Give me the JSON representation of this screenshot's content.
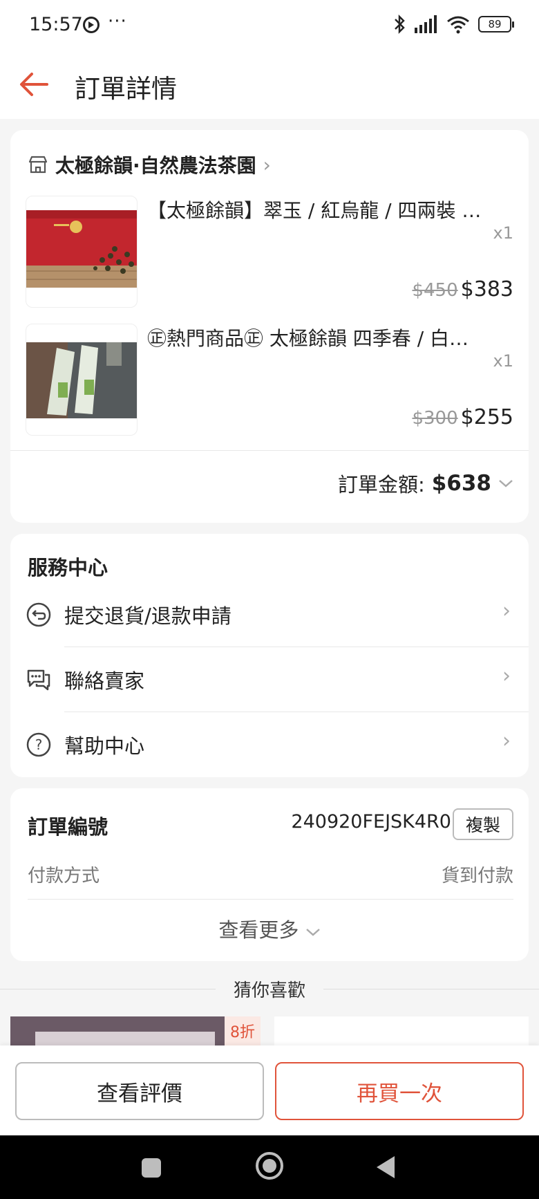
{
  "status_bar": {
    "time": "15:57",
    "dots": "···",
    "battery": "89"
  },
  "header": {
    "title": "訂單詳情"
  },
  "shop": {
    "name": "太極餘韻·自然農法茶園"
  },
  "products": [
    {
      "title": "【太極餘韻】翠玉 / 紅烏龍 / 四兩裝 …",
      "qty": "x1",
      "price_original": "$450",
      "price": "$383"
    },
    {
      "title": "㊣熱門商品㊣ 太極餘韻 四季春 / 白…",
      "qty": "x1",
      "price_original": "$300",
      "price": "$255"
    }
  ],
  "order_total": {
    "label": "訂單金額:",
    "value": "$638"
  },
  "service_center": {
    "title": "服務中心",
    "items": [
      {
        "label": "提交退貨/退款申請",
        "icon": "return-icon"
      },
      {
        "label": "聯絡賣家",
        "icon": "chat-icon"
      },
      {
        "label": "幫助中心",
        "icon": "help-icon"
      }
    ]
  },
  "order_info": {
    "number_label": "訂單編號",
    "number_value": "240920FEJSK4R0",
    "copy_label": "複製",
    "payment_label": "付款方式",
    "payment_value": "貨到付款",
    "see_more": "查看更多"
  },
  "recommend": {
    "title": "猜你喜歡",
    "badge": "8折"
  },
  "actions": {
    "review": "查看評價",
    "rebuy": "再買一次"
  },
  "colors": {
    "accent": "#e0533a",
    "background": "#f5f5f5"
  }
}
